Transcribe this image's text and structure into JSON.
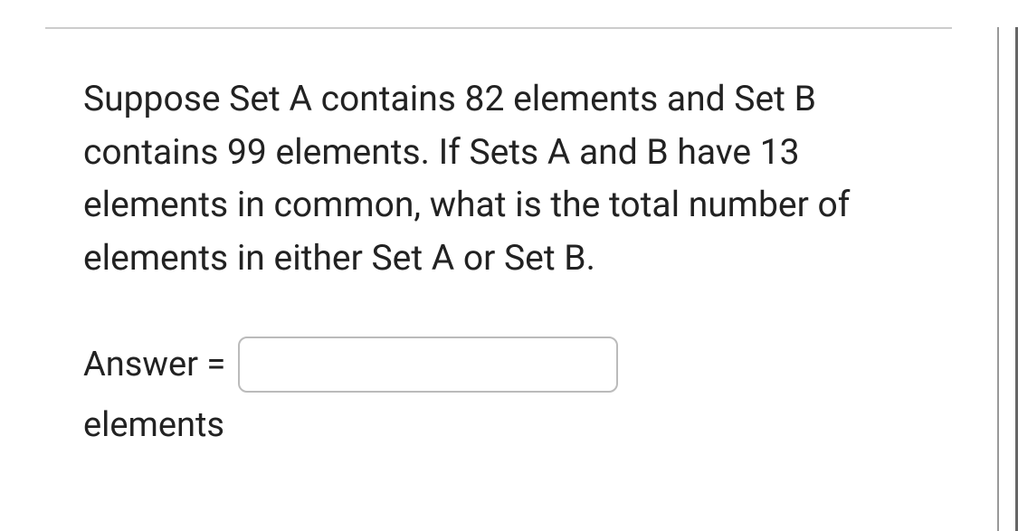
{
  "question": {
    "text": "Suppose Set A contains 82 elements and Set B contains 99 elements. If Sets A and B have 13 elements in common, what is the total number of elements in either Set A or Set B."
  },
  "answer": {
    "label": "Answer =",
    "value": "",
    "unit": "elements"
  }
}
